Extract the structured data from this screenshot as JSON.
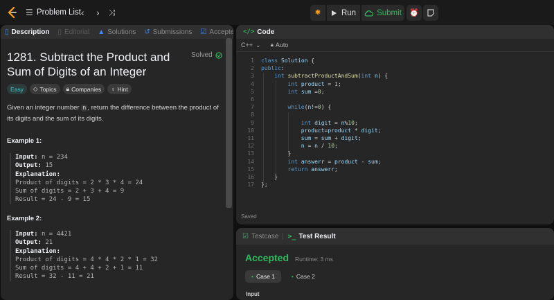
{
  "topbar": {
    "problem_list": "Problem List",
    "run": "Run",
    "submit": "Submit"
  },
  "left_tabs": {
    "description": "Description",
    "editorial": "Editorial",
    "solutions": "Solutions",
    "submissions": "Submissions",
    "accepted": "Accepted"
  },
  "problem": {
    "title": "1281. Subtract the Product and Sum of Digits of an Integer",
    "solved": "Solved",
    "tags": {
      "easy": "Easy",
      "topics": "Topics",
      "companies": "Companies",
      "hint": "Hint"
    },
    "desc_1": "Given an integer number ",
    "desc_var": "n",
    "desc_2": ", return the difference between the product of its digits and the sum of its digits."
  },
  "examples": [
    {
      "heading": "Example 1:",
      "input_label": "Input:",
      "input_value": "n = 234",
      "output_label": "Output:",
      "output_value": "15",
      "explanation_label": "Explanation:",
      "lines": [
        "Product of digits = 2 * 3 * 4 = 24",
        "Sum of digits = 2 + 3 + 4 = 9",
        "Result = 24 - 9 = 15"
      ]
    },
    {
      "heading": "Example 2:",
      "input_label": "Input:",
      "input_value": "n = 4421",
      "output_label": "Output:",
      "output_value": "21",
      "explanation_label": "Explanation:",
      "lines": [
        "Product of digits = 4 * 4 * 2 * 1 = 32",
        "Sum of digits = 4 + 4 + 2 + 1 = 11",
        "Result = 32 - 11 = 21"
      ]
    }
  ],
  "code_panel": {
    "title": "Code",
    "language": "C++",
    "mode": "Auto",
    "saved": "Saved",
    "line_numbers": [
      "1",
      "2",
      "3",
      "4",
      "5",
      "6",
      "7",
      "8",
      "9",
      "10",
      "11",
      "12",
      "13",
      "14",
      "15",
      "16",
      "17"
    ]
  },
  "result_panel": {
    "testcase_tab": "Testcase",
    "result_tab": "Test Result",
    "status": "Accepted",
    "runtime": "Runtime: 3 ms",
    "case1": "Case 1",
    "case2": "Case 2",
    "input_label": "Input"
  },
  "colors": {
    "accent_green": "#2cbb5d",
    "easy_teal": "#46c6c2",
    "code_blue": "#569cd6"
  }
}
